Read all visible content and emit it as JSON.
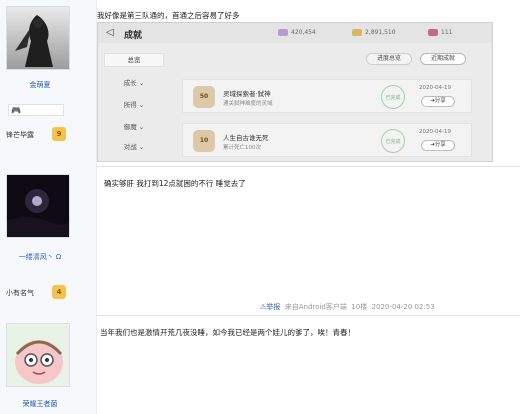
{
  "post1": {
    "username": "金萌夏",
    "level_name": "锋芒毕露",
    "level_num": "9",
    "content": "我好像是第三队通的，首通之后容易了好多",
    "game": {
      "title": "成就",
      "stat1": "420,454",
      "stat2": "2,891,510",
      "stat3": "111",
      "menu_top": "总览",
      "menu_items": [
        "成长",
        "所得",
        "御魔",
        "对战"
      ],
      "tab1": "进度总览",
      "tab2": "近期成就",
      "cards": [
        {
          "medal": "50",
          "title": "灵域探索者·弑神",
          "sub": "通关弑神难度的灵域",
          "stamp": "已完成",
          "date": "2020-04-19",
          "share": "分享"
        },
        {
          "medal": "10",
          "title": "人生自古谁无死",
          "sub": "累计死亡100次",
          "stamp": "已完成",
          "date": "2020-04-19",
          "share": "分享"
        }
      ]
    }
  },
  "post2": {
    "username": "一缕清风丶",
    "level_name": "小有名气",
    "level_num": "4",
    "content": "确实够肝 我打到12点就困的不行 睡觉去了",
    "report": "举报",
    "source": "来自Android客户端",
    "floor": "10楼",
    "datetime": "2020-04-20 02:53"
  },
  "post3": {
    "username": "荣耀王者菌",
    "content": "当年我们也是激情开荒几夜没睡，如今我已经是两个娃儿的爹了，唉！青春！"
  },
  "colors": {
    "link": "#2a5fb0",
    "badge": "#f3c34b"
  }
}
